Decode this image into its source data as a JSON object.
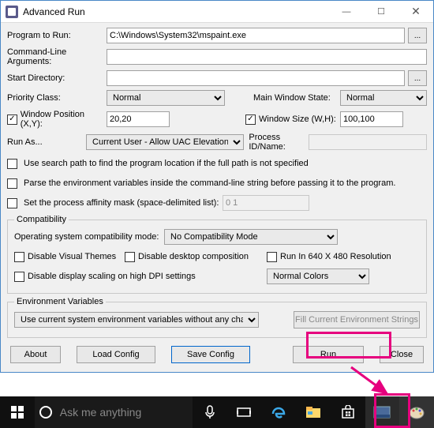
{
  "window": {
    "title": "Advanced Run",
    "min": "—",
    "max": "☐",
    "close": "✕"
  },
  "labels": {
    "program": "Program to Run:",
    "args": "Command-Line Arguments:",
    "startdir": "Start Directory:",
    "priority": "Priority Class:",
    "mainwin": "Main Window State:",
    "winpos": "Window Position (X,Y):",
    "winsize": "Window Size (W,H):",
    "runas": "Run As...",
    "procid": "Process ID/Name:",
    "usesearch": "Use search path to find the program location if the full path is not specified",
    "parseenv": "Parse the environment variables inside the command-line string before passing it to the program.",
    "affinity": "Set the process affinity mask (space-delimited list):",
    "compat_legend": "Compatibility",
    "compatmode": "Operating system compatibility mode:",
    "dis_visual": "Disable Visual Themes",
    "dis_desktop": "Disable desktop composition",
    "run640": "Run In 640 X 480 Resolution",
    "dis_dpi": "Disable display scaling on high DPI settings",
    "env_legend": "Environment Variables",
    "fillenv": "Fill Current Environment Strings",
    "browse": "..."
  },
  "values": {
    "program": "C:\\Windows\\System32\\mspaint.exe",
    "args": "",
    "startdir": "",
    "priority": "Normal",
    "mainwin": "Normal",
    "winpos": "20,20",
    "winsize": "100,100",
    "runas": "Current User - Allow UAC Elevation",
    "procid": "",
    "affinity": "0 1",
    "compatmode": "No Compatibility Mode",
    "colors": "Normal Colors",
    "envvars": "Use current system environment variables without any change"
  },
  "checks": {
    "winpos": true,
    "winsize": true,
    "usesearch": false,
    "parseenv": false,
    "affinity": false,
    "dis_visual": false,
    "dis_desktop": false,
    "run640": false,
    "dis_dpi": false
  },
  "buttons": {
    "about": "About",
    "load": "Load Config",
    "save": "Save Config",
    "run": "Run",
    "close": "Close"
  },
  "cortana": "Ask me anything"
}
